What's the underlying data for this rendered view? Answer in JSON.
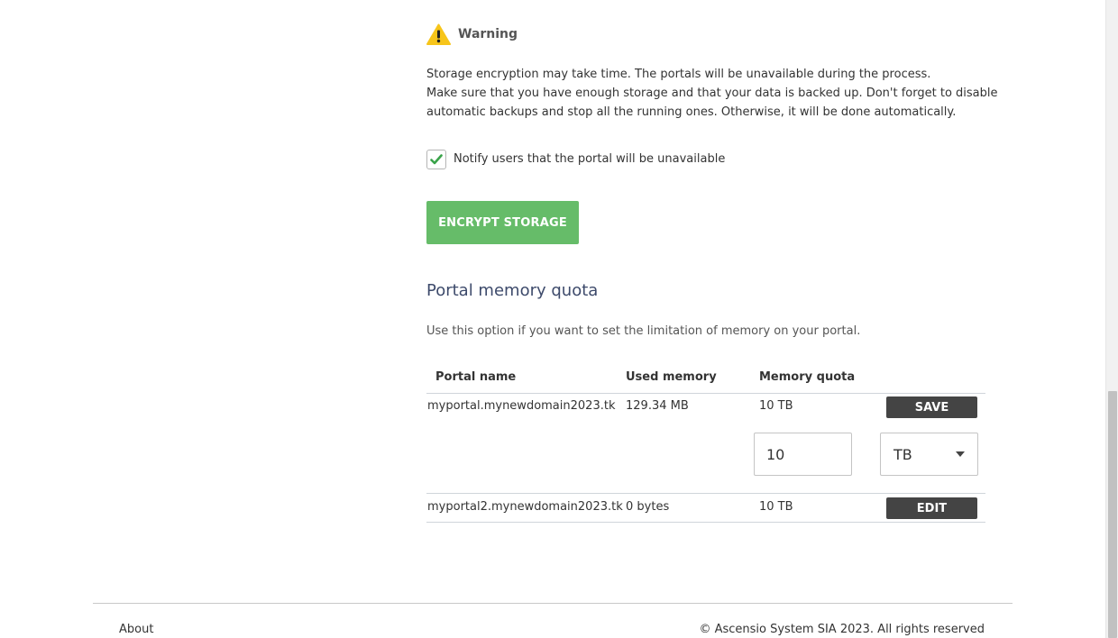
{
  "warning": {
    "title": "Warning",
    "line1": "Storage encryption may take time. The portals will be unavailable during the process.",
    "line2": "Make sure that you have enough storage and that your data is backed up. Don't forget to disable",
    "line3": "automatic backups and stop all the running ones. Otherwise, it will be done automatically."
  },
  "notify": {
    "label": "Notify users that the portal will be unavailable",
    "checked": true
  },
  "encrypt_button": "ENCRYPT STORAGE",
  "quota": {
    "title": "Portal memory quota",
    "description": "Use this option if you want to set the limitation of memory on your portal.",
    "columns": {
      "portal_name": "Portal name",
      "used_memory": "Used memory",
      "memory_quota": "Memory quota"
    },
    "rows": [
      {
        "portal": "myportal.mynewdomain2023.tk",
        "used": "129.34 MB",
        "quota": "10 TB",
        "action": "SAVE"
      },
      {
        "portal": "myportal2.mynewdomain2023.tk",
        "used": "0 bytes",
        "quota": "10 TB",
        "action": "EDIT"
      }
    ],
    "editor": {
      "value": "10",
      "unit": "TB"
    }
  },
  "footer": {
    "about": "About",
    "copyright": "© Ascensio System SIA 2023. All rights reserved"
  },
  "colors": {
    "accent_green": "#66bc69",
    "dark_button": "#444444",
    "warning_yellow": "#f7c51a",
    "title_blue": "#3d4a6b"
  }
}
